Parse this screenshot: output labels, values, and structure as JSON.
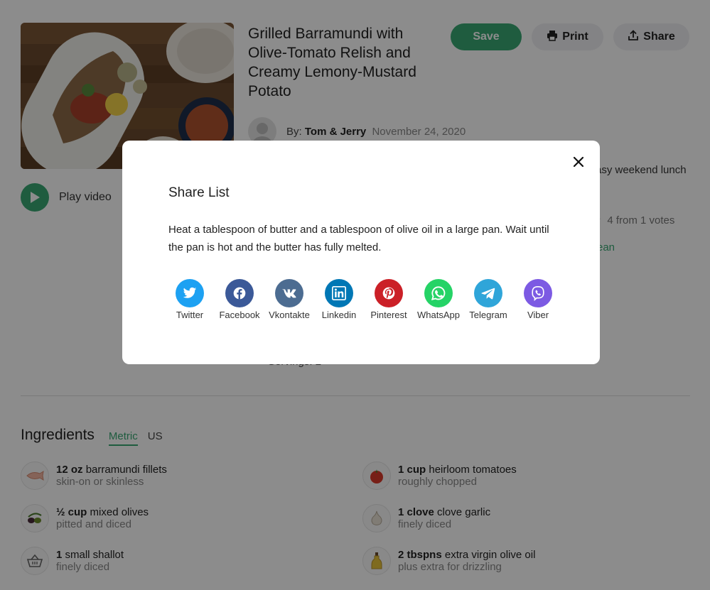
{
  "recipe": {
    "title": "Grilled Barramundi with Olive-Tomato Relish and Creamy Lemony-Mustard Potato",
    "play_label": "Play video",
    "by_label": "By:",
    "author": "Tom & Jerry",
    "date": "November 24, 2020",
    "description_tail": "asy weekend lunch",
    "rating_text": "4 from 1 votes",
    "tag_tail": "ean",
    "servings_text": "Servings: 2"
  },
  "actions": {
    "save_label": "Save",
    "print_label": "Print",
    "share_label": "Share"
  },
  "ingredients": {
    "title": "Ingredients",
    "units": [
      "Metric",
      "US"
    ],
    "active_unit": "Metric",
    "items": [
      {
        "qty": "12 oz",
        "name": "barramundi fillets",
        "note": "skin-on or skinless",
        "icon": "fish-icon"
      },
      {
        "qty": "1 cup",
        "name": "heirloom tomatoes",
        "note": "roughly chopped",
        "icon": "tomato-icon"
      },
      {
        "qty": "½ cup",
        "name": "mixed olives",
        "note": "pitted and diced",
        "icon": "olives-icon"
      },
      {
        "qty": "1 clove",
        "name": "clove garlic",
        "note": "finely diced",
        "icon": "garlic-icon"
      },
      {
        "qty": "1",
        "name": "small shallot",
        "note": "finely diced",
        "icon": "basket-icon"
      },
      {
        "qty": "2 tbspns",
        "name": "extra virgin olive oil",
        "note": "plus extra for drizzling",
        "icon": "oil-bottle-icon"
      }
    ]
  },
  "modal": {
    "title": "Share List",
    "text": "Heat a tablespoon of butter and a tablespoon of olive oil in a large pan. Wait until the pan is hot and the butter has fully melted.",
    "networks": [
      {
        "label": "Twitter",
        "color": "#1da1f2",
        "icon": "twitter-icon"
      },
      {
        "label": "Facebook",
        "color": "#3b5998",
        "icon": "facebook-icon"
      },
      {
        "label": "Vkontakte",
        "color": "#4c6c91",
        "icon": "vk-icon"
      },
      {
        "label": "Linkedin",
        "color": "#0077b5",
        "icon": "linkedin-icon"
      },
      {
        "label": "Pinterest",
        "color": "#cb2027",
        "icon": "pinterest-icon"
      },
      {
        "label": "WhatsApp",
        "color": "#25d366",
        "icon": "whatsapp-icon"
      },
      {
        "label": "Telegram",
        "color": "#2fa5d9",
        "icon": "telegram-icon"
      },
      {
        "label": "Viber",
        "color": "#7c5ae3",
        "icon": "viber-icon"
      }
    ]
  },
  "colors": {
    "accent": "#3aa874",
    "overlay": "rgba(0,0,0,0.45)"
  }
}
